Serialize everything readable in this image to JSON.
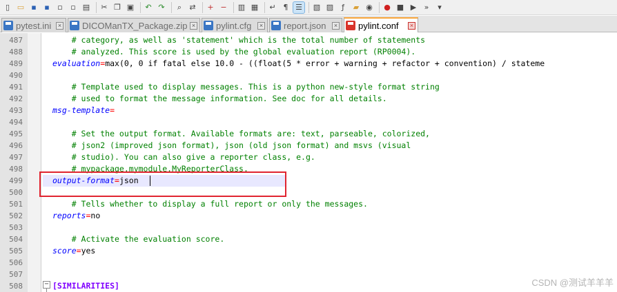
{
  "colors": {
    "comment": "#008000",
    "key": "#0000ff",
    "operator": "#ff0000",
    "section": "#8000ff",
    "highlight_box": "#e0232f",
    "active_tab_accent": "#f7a53a"
  },
  "toolbar": {
    "icons": [
      "new-file-icon",
      "open-file-icon",
      "save-icon",
      "save-all-icon",
      "close-icon",
      "close-all-icon",
      "print-icon",
      "cut-icon",
      "copy-icon",
      "paste-icon",
      "undo-icon",
      "redo-icon",
      "find-icon",
      "replace-icon",
      "zoom-in-icon",
      "zoom-out-icon",
      "sync-vertical-icon",
      "sync-horizontal-icon",
      "word-wrap-icon",
      "show-all-chars-icon",
      "indent-guide-icon",
      "language-icon",
      "doc-map-icon",
      "function-list-icon",
      "folder-workspace-icon",
      "monitor-icon",
      "record-macro-icon",
      "stop-macro-icon",
      "play-macro-icon",
      "run-macro-multiple-icon",
      "save-macro-icon"
    ]
  },
  "tabs": [
    {
      "label": "pytest.ini",
      "active": false
    },
    {
      "label": "DICOManTX_Package.zip",
      "active": false
    },
    {
      "label": "pylint.cfg",
      "active": false
    },
    {
      "label": "report.json",
      "active": false
    },
    {
      "label": "pylint.conf",
      "active": true
    }
  ],
  "lines": [
    {
      "num": "487",
      "tokens": [
        {
          "t": "    # category, as well as 'statement' which is the total number of statements",
          "c": "comment"
        }
      ]
    },
    {
      "num": "488",
      "tokens": [
        {
          "t": "    # analyzed. This score is used by the global evaluation report (RP0004).",
          "c": "comment"
        }
      ]
    },
    {
      "num": "489",
      "tokens": [
        {
          "t": "evaluation",
          "c": "key"
        },
        {
          "t": "=",
          "c": "op"
        },
        {
          "t": "max(0, 0 if fatal else 10.0 - ((float(5 * error + warning + refactor + convention) / stateme",
          "c": "value"
        }
      ]
    },
    {
      "num": "490",
      "tokens": []
    },
    {
      "num": "491",
      "tokens": [
        {
          "t": "    # Template used to display messages. This is a python new-style format string",
          "c": "comment"
        }
      ]
    },
    {
      "num": "492",
      "tokens": [
        {
          "t": "    # used to format the message information. See doc for all details.",
          "c": "comment"
        }
      ]
    },
    {
      "num": "493",
      "tokens": [
        {
          "t": "msg-template",
          "c": "key"
        },
        {
          "t": "=",
          "c": "op"
        }
      ]
    },
    {
      "num": "494",
      "tokens": []
    },
    {
      "num": "495",
      "tokens": [
        {
          "t": "    # Set the output format. Available formats are: text, parseable, colorized,",
          "c": "comment"
        }
      ]
    },
    {
      "num": "496",
      "tokens": [
        {
          "t": "    # json2 (improved json format), json (old json format) and msvs (visual",
          "c": "comment"
        }
      ]
    },
    {
      "num": "497",
      "tokens": [
        {
          "t": "    # studio). You can also give a reporter class, e.g.",
          "c": "comment"
        }
      ]
    },
    {
      "num": "498",
      "tokens": [
        {
          "t": "    # mypackage.mymodule.MyReporterClass.",
          "c": "comment"
        }
      ]
    },
    {
      "num": "499",
      "tokens": [
        {
          "t": "output-format",
          "c": "key"
        },
        {
          "t": "=",
          "c": "op"
        },
        {
          "t": "json",
          "c": "value"
        }
      ],
      "current": true
    },
    {
      "num": "500",
      "tokens": []
    },
    {
      "num": "501",
      "tokens": [
        {
          "t": "    # Tells whether to display a full report or only the messages.",
          "c": "comment"
        }
      ]
    },
    {
      "num": "502",
      "tokens": [
        {
          "t": "reports",
          "c": "key"
        },
        {
          "t": "=",
          "c": "op"
        },
        {
          "t": "no",
          "c": "value"
        }
      ]
    },
    {
      "num": "503",
      "tokens": []
    },
    {
      "num": "504",
      "tokens": [
        {
          "t": "    # Activate the evaluation score.",
          "c": "comment"
        }
      ]
    },
    {
      "num": "505",
      "tokens": [
        {
          "t": "score",
          "c": "key"
        },
        {
          "t": "=",
          "c": "op"
        },
        {
          "t": "yes",
          "c": "value"
        }
      ]
    },
    {
      "num": "506",
      "tokens": []
    },
    {
      "num": "507",
      "tokens": []
    },
    {
      "num": "508",
      "tokens": [
        {
          "t": "[SIMILARITIES]",
          "c": "section"
        }
      ],
      "fold": true
    }
  ],
  "watermark": "CSDN @测试羊羊羊"
}
